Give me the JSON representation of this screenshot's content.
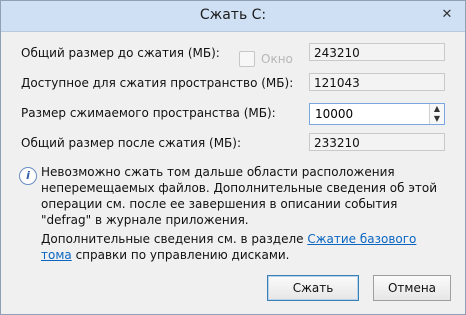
{
  "window": {
    "title": "Сжать C:",
    "close_glyph": "✕"
  },
  "rows": [
    {
      "label": "Общий размер до сжатия (МБ):",
      "value": "243210"
    },
    {
      "label": "Доступное для сжатия пространство (МБ):",
      "value": "121043"
    },
    {
      "label": "Размер сжимаемого пространства (МБ):",
      "value": "10000"
    },
    {
      "label": "Общий размер после сжатия (МБ):",
      "value": "233210"
    }
  ],
  "ghost": {
    "text": "Окно"
  },
  "info": {
    "text": "Невозможно сжать том дальше области расположения неперемещаемых файлов. Дополнительные сведения об этой операции см. после ее завершения в описании события \"defrag\" в журнале приложения."
  },
  "more": {
    "prefix": "Дополнительные сведения см. в разделе ",
    "link": "Сжатие базового тома",
    "suffix": " справки по управлению дисками."
  },
  "buttons": {
    "ok": "Сжать",
    "cancel": "Отмена"
  },
  "icons": {
    "info": "info-icon",
    "close": "close-icon",
    "spin_up": "chevron-up-icon",
    "spin_down": "chevron-down-icon"
  }
}
